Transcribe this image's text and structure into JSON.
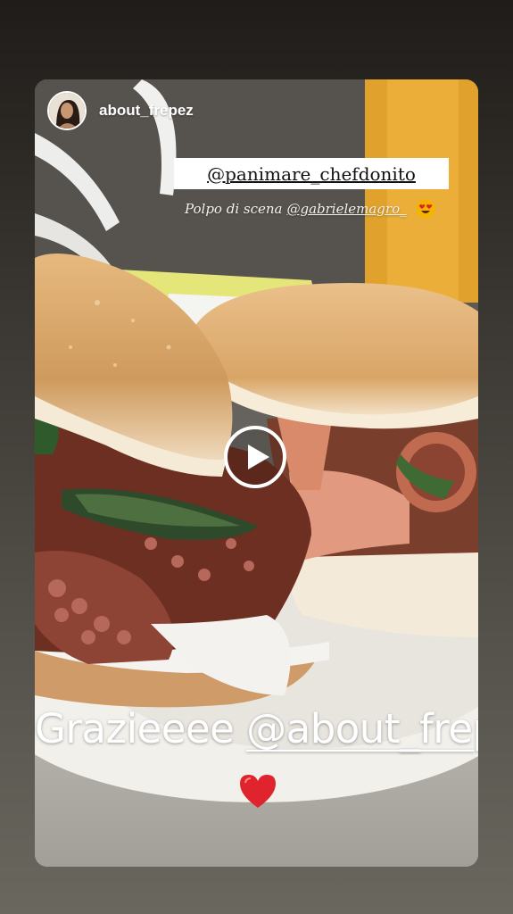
{
  "story": {
    "username": "about_frepez",
    "mention_sticker": "@panimare_chefdonito",
    "caption_prefix": "Polpo di scena",
    "caption_tag": "@gabrielemagro_",
    "emoji_caption": "heart-eyes-emoji",
    "main_text_prefix": "Grazieeee",
    "main_text_handle": "@about_frepez",
    "bottom_emoji": "red-heart-emoji",
    "play_icon": "play-icon"
  },
  "colors": {
    "background_top": "#1f1c19",
    "background_bottom": "#6a675f",
    "sticker_bg": "#ffffff",
    "heart": "#e0242e",
    "heart_eyes_face": "#f4b400"
  }
}
